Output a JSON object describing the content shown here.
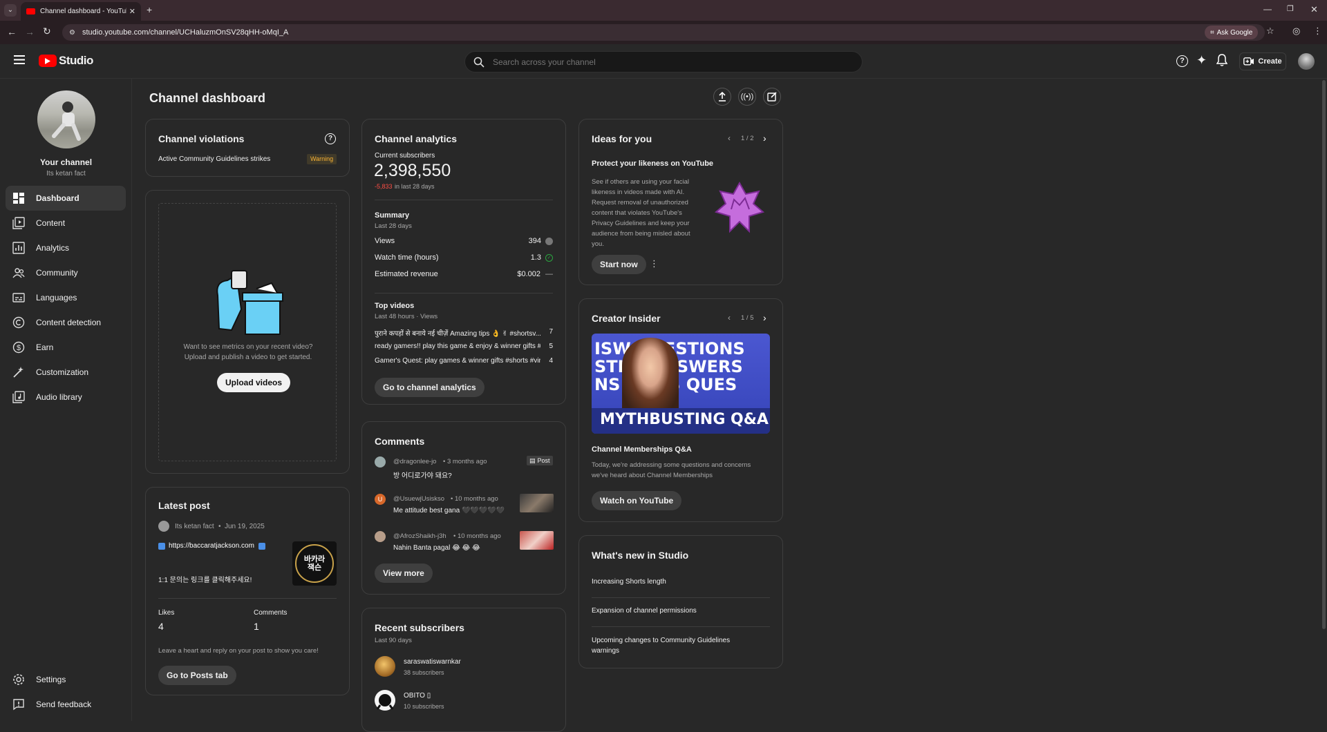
{
  "browser": {
    "tab_title": "Channel dashboard - YouTube",
    "url": "studio.youtube.com/channel/UCHaluzmOnSV28qHH-oMqI_A",
    "ask_google": "Ask Google"
  },
  "header": {
    "logo_text": "Studio",
    "search_placeholder": "Search across your channel",
    "create_label": "Create"
  },
  "sidebar": {
    "channel_title": "Your channel",
    "channel_name": "Its ketan fact",
    "items": [
      {
        "label": "Dashboard"
      },
      {
        "label": "Content"
      },
      {
        "label": "Analytics"
      },
      {
        "label": "Community"
      },
      {
        "label": "Languages"
      },
      {
        "label": "Content detection"
      },
      {
        "label": "Earn"
      },
      {
        "label": "Customization"
      },
      {
        "label": "Audio library"
      }
    ],
    "settings": "Settings",
    "feedback": "Send feedback"
  },
  "page": {
    "title": "Channel dashboard"
  },
  "violations": {
    "title": "Channel violations",
    "text": "Active Community Guidelines strikes",
    "badge": "Warning"
  },
  "upload": {
    "line1": "Want to see metrics on your recent video?",
    "line2": "Upload and publish a video to get started.",
    "button": "Upload videos"
  },
  "latest_post": {
    "title": "Latest post",
    "author": "Its ketan fact",
    "date": "Jun 19, 2025",
    "link": "https://baccaratjackson.com",
    "text": "1:1 문의는 링크를 클릭해주세요!",
    "thumb_text": "바카라 잭슨",
    "likes_label": "Likes",
    "likes": "4",
    "comments_label": "Comments",
    "comments": "1",
    "hint": "Leave a heart and reply on your post to show you care!",
    "button": "Go to Posts tab"
  },
  "analytics": {
    "title": "Channel analytics",
    "subs_label": "Current subscribers",
    "subs": "2,398,550",
    "change": "-5,833",
    "change_suffix": "in last 28 days",
    "summary_title": "Summary",
    "summary_sub": "Last 28 days",
    "rows": [
      {
        "label": "Views",
        "value": "394"
      },
      {
        "label": "Watch time (hours)",
        "value": "1.3"
      },
      {
        "label": "Estimated revenue",
        "value": "$0.002"
      }
    ],
    "top_title": "Top videos",
    "top_sub": "Last 48 hours · Views",
    "videos": [
      {
        "title": "पुराने कपड़ों से बनाये नई चीज़ें Amazing tips 👌 ✌ #shortsv...",
        "views": "7"
      },
      {
        "title": "ready gamers!! play this game & enjoy & winner gifts #s...",
        "views": "5"
      },
      {
        "title": "Gamer's Quest: play games & winner gifts #shorts #viral",
        "views": "4"
      }
    ],
    "button": "Go to channel analytics"
  },
  "comments": {
    "title": "Comments",
    "items": [
      {
        "user": "@dragonlee-jo",
        "time": "• 3 months ago",
        "text": "방 어디로가야 돼요?",
        "tag": "Post"
      },
      {
        "user": "@UsuewjUsiskso",
        "time": "• 10 months ago",
        "text": "Me attitude best gana 🖤🖤🖤🖤🖤"
      },
      {
        "user": "@AfrozShaikh-j3h",
        "time": "• 10 months ago",
        "text": "Nahin Banta pagal 😂 😂 😂"
      }
    ],
    "button": "View more"
  },
  "recent_subs": {
    "title": "Recent subscribers",
    "sub": "Last 90 days",
    "items": [
      {
        "name": "saraswatiswarnkar",
        "count": "38 subscribers"
      },
      {
        "name": "OBITO ▯",
        "count": "10 subscribers"
      }
    ]
  },
  "ideas": {
    "title": "Ideas for you",
    "pager": "1 / 2",
    "heading": "Protect your likeness on YouTube",
    "body": "See if others are using your facial likeness in videos made with AI. Request removal of unauthorized content that violates YouTube's Privacy Guidelines and keep your audience from being misled about you.",
    "button": "Start now"
  },
  "insider": {
    "title": "Creator Insider",
    "pager": "1 / 5",
    "thumb_lines": [
      "ISW QUESTIONS",
      "STI & ANSWERS",
      "NS WERS QUES"
    ],
    "thumb_bottom": "MYTHBUSTING Q&A",
    "heading": "Channel Memberships Q&A",
    "body": "Today, we're addressing some questions and concerns we've heard about Channel Memberships",
    "button": "Watch on YouTube"
  },
  "whats_new": {
    "title": "What's new in Studio",
    "items": [
      "Increasing Shorts length",
      "Expansion of channel permissions",
      "Upcoming changes to Community Guidelines warnings"
    ]
  },
  "colors": {
    "accent_red": "#ff0000",
    "warning": "#f9b233",
    "negative": "#ff4e45",
    "positive": "#2ba640"
  }
}
